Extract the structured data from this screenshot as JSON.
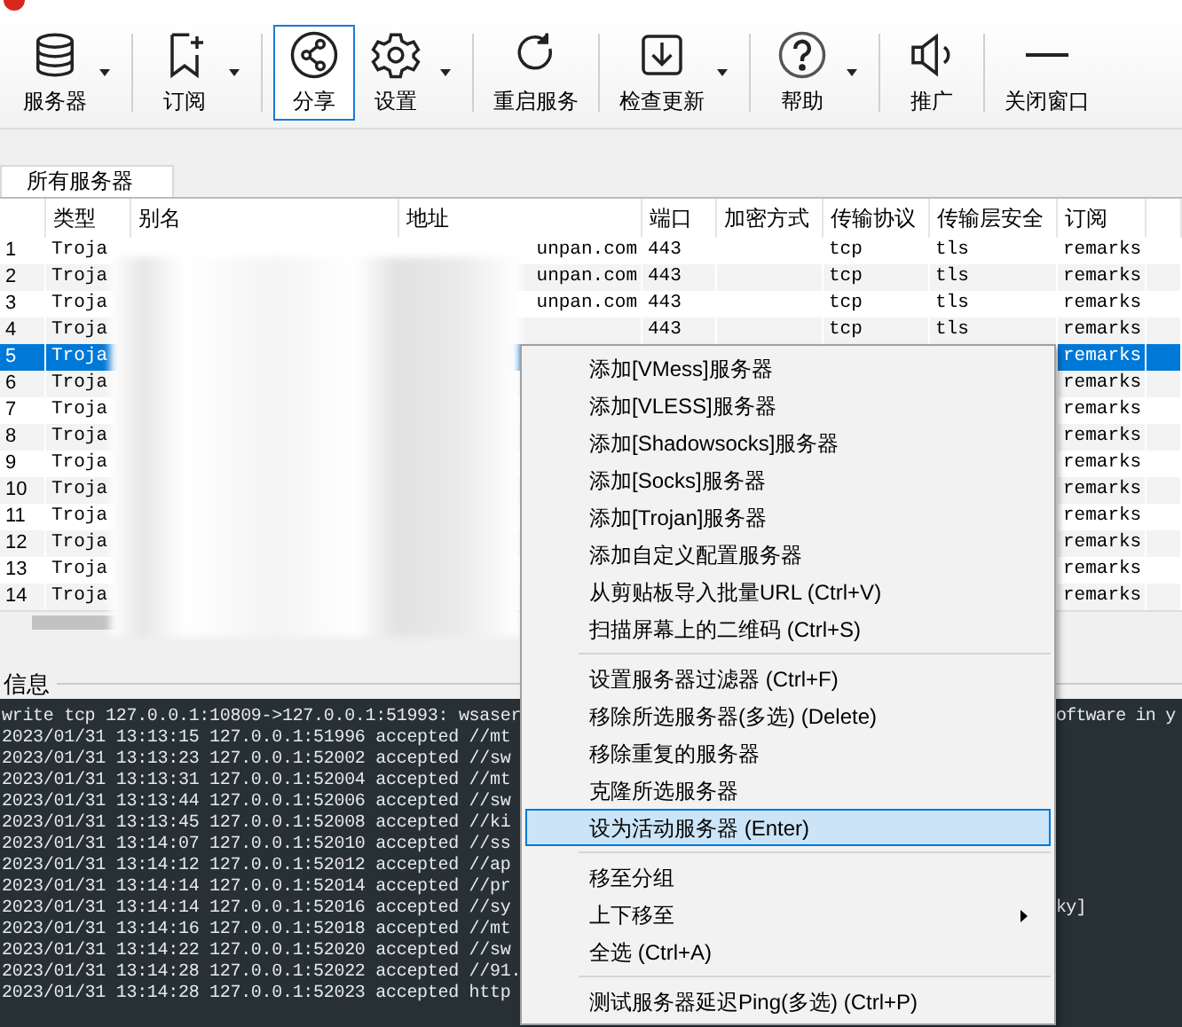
{
  "toolbar": [
    {
      "label": "服务器",
      "dropdown": true,
      "selected": false
    },
    {
      "label": "订阅",
      "dropdown": true,
      "selected": false
    },
    {
      "label": "分享",
      "dropdown": false,
      "selected": true
    },
    {
      "label": "设置",
      "dropdown": true,
      "selected": false
    },
    {
      "label": "重启服务",
      "dropdown": false,
      "selected": false
    },
    {
      "label": "检查更新",
      "dropdown": true,
      "selected": false
    },
    {
      "label": "帮助",
      "dropdown": true,
      "selected": false
    },
    {
      "label": "推广",
      "dropdown": false,
      "selected": false
    },
    {
      "label": "关闭窗口",
      "dropdown": false,
      "selected": false
    }
  ],
  "tabs": [
    {
      "label": "所有服务器",
      "selected": true
    }
  ],
  "table": {
    "columns": [
      "类型",
      "别名",
      "地址",
      "端口",
      "加密方式",
      "传输协议",
      "传输层安全",
      "订阅"
    ],
    "rows": [
      {
        "num": "1",
        "type": "Troja",
        "address": "unpan.com",
        "port": "443",
        "network": "tcp",
        "security": "tls",
        "subscription": "remarks",
        "selected": false
      },
      {
        "num": "2",
        "type": "Troja",
        "address": "unpan.com",
        "port": "443",
        "network": "tcp",
        "security": "tls",
        "subscription": "remarks",
        "selected": false
      },
      {
        "num": "3",
        "type": "Troja",
        "address": "unpan.com",
        "port": "443",
        "network": "tcp",
        "security": "tls",
        "subscription": "remarks",
        "selected": false
      },
      {
        "num": "4",
        "type": "Troja",
        "port": "443",
        "network": "tcp",
        "security": "tls",
        "subscription": "remarks",
        "selected": false
      },
      {
        "num": "5",
        "type": "Troja",
        "subscription": "remarks",
        "selected": true
      },
      {
        "num": "6",
        "type": "Troja",
        "subscription": "remarks",
        "selected": false
      },
      {
        "num": "7",
        "type": "Troja",
        "subscription": "remarks",
        "selected": false
      },
      {
        "num": "8",
        "type": "Troja",
        "subscription": "remarks",
        "selected": false
      },
      {
        "num": "9",
        "type": "Troja",
        "subscription": "remarks",
        "selected": false
      },
      {
        "num": "10",
        "type": "Troja",
        "subscription": "remarks",
        "selected": false
      },
      {
        "num": "11",
        "type": "Troja",
        "subscription": "remarks",
        "selected": false
      },
      {
        "num": "12",
        "type": "Troja",
        "subscription": "remarks",
        "selected": false
      },
      {
        "num": "13",
        "type": "Troja",
        "subscription": "remarks",
        "selected": false
      },
      {
        "num": "14",
        "type": "Troja",
        "subscription": "remarks",
        "selected": false
      }
    ]
  },
  "info": {
    "title": "信息",
    "log": [
      {
        "text": "write tcp 127.0.0.1:10809->127.0.0.1:51993: wsaser",
        "tail": "oftware in y"
      },
      {
        "text": "2023/01/31 13:13:15 127.0.0.1:51996 accepted //mt"
      },
      {
        "text": "2023/01/31 13:13:23 127.0.0.1:52002 accepted //sw"
      },
      {
        "text": "2023/01/31 13:13:31 127.0.0.1:52004 accepted //mt"
      },
      {
        "text": "2023/01/31 13:13:44 127.0.0.1:52006 accepted //sw"
      },
      {
        "text": "2023/01/31 13:13:45 127.0.0.1:52008 accepted //ki"
      },
      {
        "text": "2023/01/31 13:14:07 127.0.0.1:52010 accepted //ss"
      },
      {
        "text": "2023/01/31 13:14:12 127.0.0.1:52012 accepted //ap"
      },
      {
        "text": "2023/01/31 13:14:14 127.0.0.1:52014 accepted //pr"
      },
      {
        "text": "2023/01/31 13:14:14 127.0.0.1:52016 accepted //sy",
        "tail": "ky]"
      },
      {
        "text": "2023/01/31 13:14:16 127.0.0.1:52018 accepted //mt"
      },
      {
        "text": "2023/01/31 13:14:22 127.0.0.1:52020 accepted //sw"
      },
      {
        "text": "2023/01/31 13:14:28 127.0.0.1:52022 accepted //91."
      },
      {
        "text": "2023/01/31 13:14:28 127.0.0.1:52023 accepted http"
      }
    ]
  },
  "context_menu": [
    {
      "kind": "item",
      "label": "添加[VMess]服务器",
      "selected": false
    },
    {
      "kind": "item",
      "label": "添加[VLESS]服务器",
      "selected": false
    },
    {
      "kind": "item",
      "label": "添加[Shadowsocks]服务器",
      "selected": false
    },
    {
      "kind": "item",
      "label": "添加[Socks]服务器",
      "selected": false
    },
    {
      "kind": "item",
      "label": "添加[Trojan]服务器",
      "selected": false
    },
    {
      "kind": "item",
      "label": "添加自定义配置服务器",
      "selected": false
    },
    {
      "kind": "item",
      "label": "从剪贴板导入批量URL (Ctrl+V)",
      "selected": false
    },
    {
      "kind": "item",
      "label": "扫描屏幕上的二维码 (Ctrl+S)",
      "selected": false
    },
    {
      "kind": "separator"
    },
    {
      "kind": "item",
      "label": "设置服务器过滤器 (Ctrl+F)",
      "selected": false
    },
    {
      "kind": "item",
      "label": "移除所选服务器(多选) (Delete)",
      "selected": false
    },
    {
      "kind": "item",
      "label": "移除重复的服务器",
      "selected": false
    },
    {
      "kind": "item",
      "label": "克隆所选服务器",
      "selected": false
    },
    {
      "kind": "item",
      "label": "设为活动服务器 (Enter)",
      "selected": true
    },
    {
      "kind": "separator"
    },
    {
      "kind": "item",
      "label": "移至分组",
      "selected": false
    },
    {
      "kind": "submenu",
      "label": "上下移至",
      "selected": false
    },
    {
      "kind": "item",
      "label": "全选 (Ctrl+A)",
      "selected": false
    },
    {
      "kind": "separator"
    },
    {
      "kind": "item",
      "label": "测试服务器延迟Ping(多选) (Ctrl+P)",
      "selected": false
    }
  ]
}
